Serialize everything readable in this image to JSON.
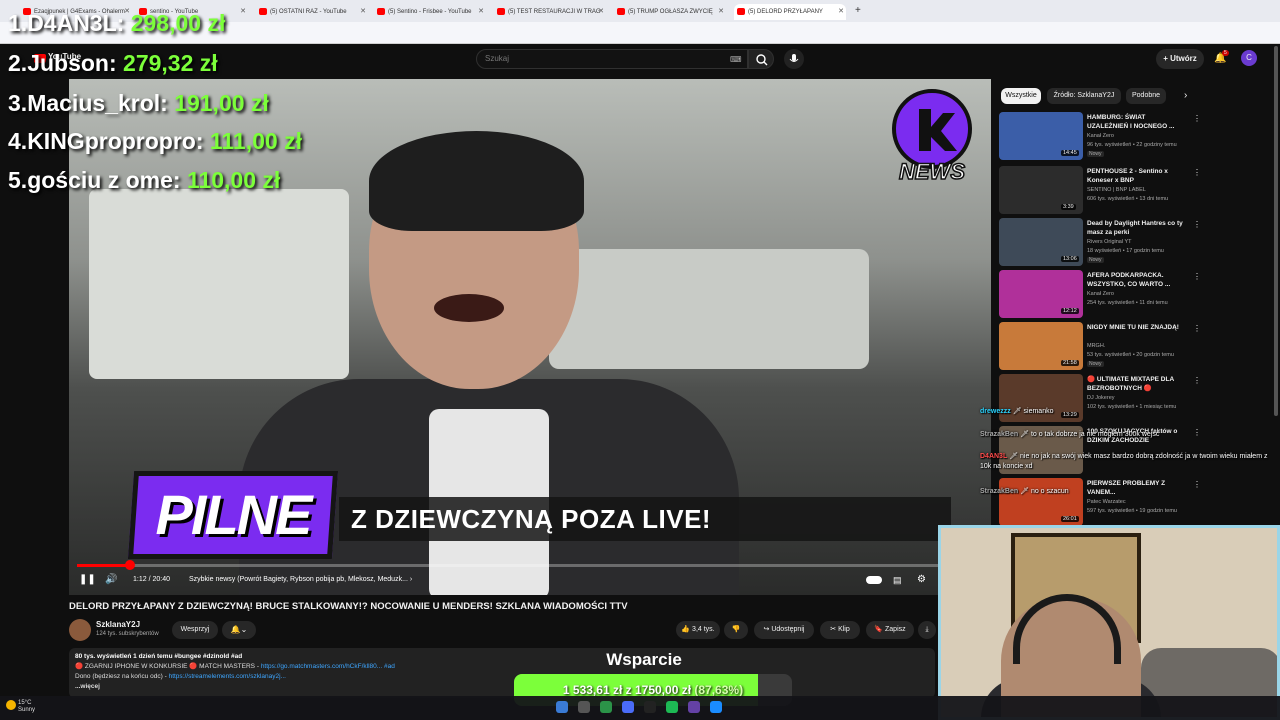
{
  "browser": {
    "tabs": [
      {
        "label": "Ezaqjpunek | G4Exams - Ohalerm"
      },
      {
        "label": "sentino - YouTube"
      },
      {
        "label": "(5) OSTATNI RAZ - YouTube"
      },
      {
        "label": "(5) Sentino - Frisbee - YouTube"
      },
      {
        "label": "(5) TEST RESTAURACJI W TRAG"
      },
      {
        "label": "(5) TRUMP OGŁASZA ZWYCIĘ"
      },
      {
        "label": "(5) DELORD PRZYŁAPANY"
      }
    ],
    "new_tab": "+"
  },
  "youtube": {
    "logo": "YouTube",
    "search_placeholder": "Szukaj",
    "create_label": "+ Utwórz",
    "notif_count": "5",
    "avatar_letter": "C"
  },
  "video": {
    "pilne": "PILNE",
    "headline": "Z DZIEWCZYNĄ POZA LIVE!",
    "logo_text": "NEWS",
    "time": "1:12 / 20:40",
    "chapter": "Szybkie newsy (Powrót Bagiety, Rybson pobija pb, Mlekosz, Meduzk... ›",
    "progress": 0.058,
    "title": "DELORD PRZYŁAPANY Z DZIEWCZYNĄ! BRUCE STALKOWANY!? NOCOWANIE U MENDERS! SZKLANA WIADOMOŚCI TTV",
    "channel": "SzklanaY2J",
    "subscribers": "124 tys. subskrybentów",
    "support_label": "Wesprzyj",
    "likes": "3,4 tys.",
    "share_label": "Udostępnij",
    "clip_label": "Klip",
    "save_label": "Zapisz",
    "desc_line1": "80 tys. wyświetleń  1 dzień temu  #bungee #dzinold #ad",
    "desc_line2a": "🔴 ZGARNIJ IPHONE W KONKURSIE 🔴 MATCH MASTERS - ",
    "desc_link1": "https://go.matchmasters.com/hCkF/kll80...",
    "desc_tag": "#ad",
    "desc_line3a": "Dono (będziesz na końcu odc) - ",
    "desc_link2": "https://streamelements.com/szklanay2j...",
    "desc_more": "...więcej"
  },
  "sidebar": {
    "chips": [
      "Wszystkie",
      "Źródło: SzklanaY2J",
      "Podobne"
    ],
    "recs": [
      {
        "title": "HAMBURG: ŚWIAT UZALEŻNIEŃ I NOCNEGO ...",
        "channel": "Kanał Zero",
        "meta": "96 tys. wyświetleń • 22 godziny temu",
        "badge": "Nowy",
        "duration": "14:45",
        "color": "#3b5ea8"
      },
      {
        "title": "PENTHOUSE 2 - Sentino x Koneser x BNP",
        "channel": "SENTINO | BNP LABEL",
        "meta": "606 tys. wyświetleń • 13 dni temu",
        "badge": "",
        "duration": "3:39",
        "color": "#2c2c2c"
      },
      {
        "title": "Dead by Daylight  Hantres co ty masz  za perki",
        "channel": "Rivers Original YT",
        "meta": "18 wyświetleń • 17 godzin temu",
        "badge": "Nowy",
        "duration": "13:06",
        "color": "#3e4a58"
      },
      {
        "title": "AFERA PODKARPACKA. WSZYSTKO, CO WARTO ...",
        "channel": "Kanał Zero",
        "meta": "254 tys. wyświetleń • 11 dni temu",
        "badge": "",
        "duration": "12:12",
        "color": "#b0309a"
      },
      {
        "title": "NIGDY MNIE TU NIE ZNAJDĄ!",
        "channel": "MRGH.",
        "meta": "53 tys. wyświetleń • 20 godzin temu",
        "badge": "Nowy",
        "duration": "21:58",
        "color": "#c87a3a"
      },
      {
        "title": "🔴 ULTIMATE MIXTAPE DLA BEZROBOTNYCH 🔴",
        "channel": "DJ Jokerey",
        "meta": "102 tys. wyświetleń • 1 miesiąc temu",
        "badge": "",
        "duration": "13:29",
        "color": "#5a3a2a"
      },
      {
        "title": "100 SZOKUJĄCYCH faktów o DZIKIM ZACHODZIE",
        "channel": "",
        "meta": "",
        "badge": "",
        "duration": "",
        "color": "#6a5a4a"
      },
      {
        "title": "PIERWSZE PROBLEMY Z VANEM...",
        "channel": "Patec Warzatec",
        "meta": "597 tys. wyświetleń • 19 godzin temu",
        "badge": "",
        "duration": "26:01",
        "color": "#c04020"
      }
    ]
  },
  "chat": [
    {
      "user": "drewezzz",
      "badge": "🗡",
      "text": "siemanko",
      "color": "#2ad4ff"
    },
    {
      "user": "StrazakBen",
      "badge": "🗡",
      "text": "to o tak dobrze ja nie mogłem 300k wejść",
      "color": "#aaaaaa"
    },
    {
      "user": "D4AN3L",
      "badge": "🗡",
      "text": "nie no jak na swój wiek masz bardzo dobrą zdolność ja w twoim wieku miałem z 10k na koncie xd",
      "color": "#ff4a4a"
    },
    {
      "user": "StrazakBen",
      "badge": "🗡",
      "text": "no o szacun",
      "color": "#aaaaaa"
    }
  ],
  "leaderboard": [
    {
      "rank": "1.",
      "name": "D4AN3L:",
      "amount": "298,00 zł"
    },
    {
      "rank": "2.",
      "name": "Jubson:",
      "amount": "279,32 zł"
    },
    {
      "rank": "3.",
      "name": "Macius_krol:",
      "amount": "191,00 zł"
    },
    {
      "rank": "4.",
      "name": "KINGpropropro:",
      "amount": "111,00 zł"
    },
    {
      "rank": "5.",
      "name": "gościu z ome:",
      "amount": "110,00 zł"
    }
  ],
  "donation": {
    "title": "Wsparcie",
    "current": "1 533,61 zł",
    "separator": "z",
    "goal": "1750,00 zł",
    "percent": "(87,63%)",
    "progress": 0.8763
  },
  "taskbar": {
    "temp": "15°C",
    "weather": "Sunny"
  }
}
